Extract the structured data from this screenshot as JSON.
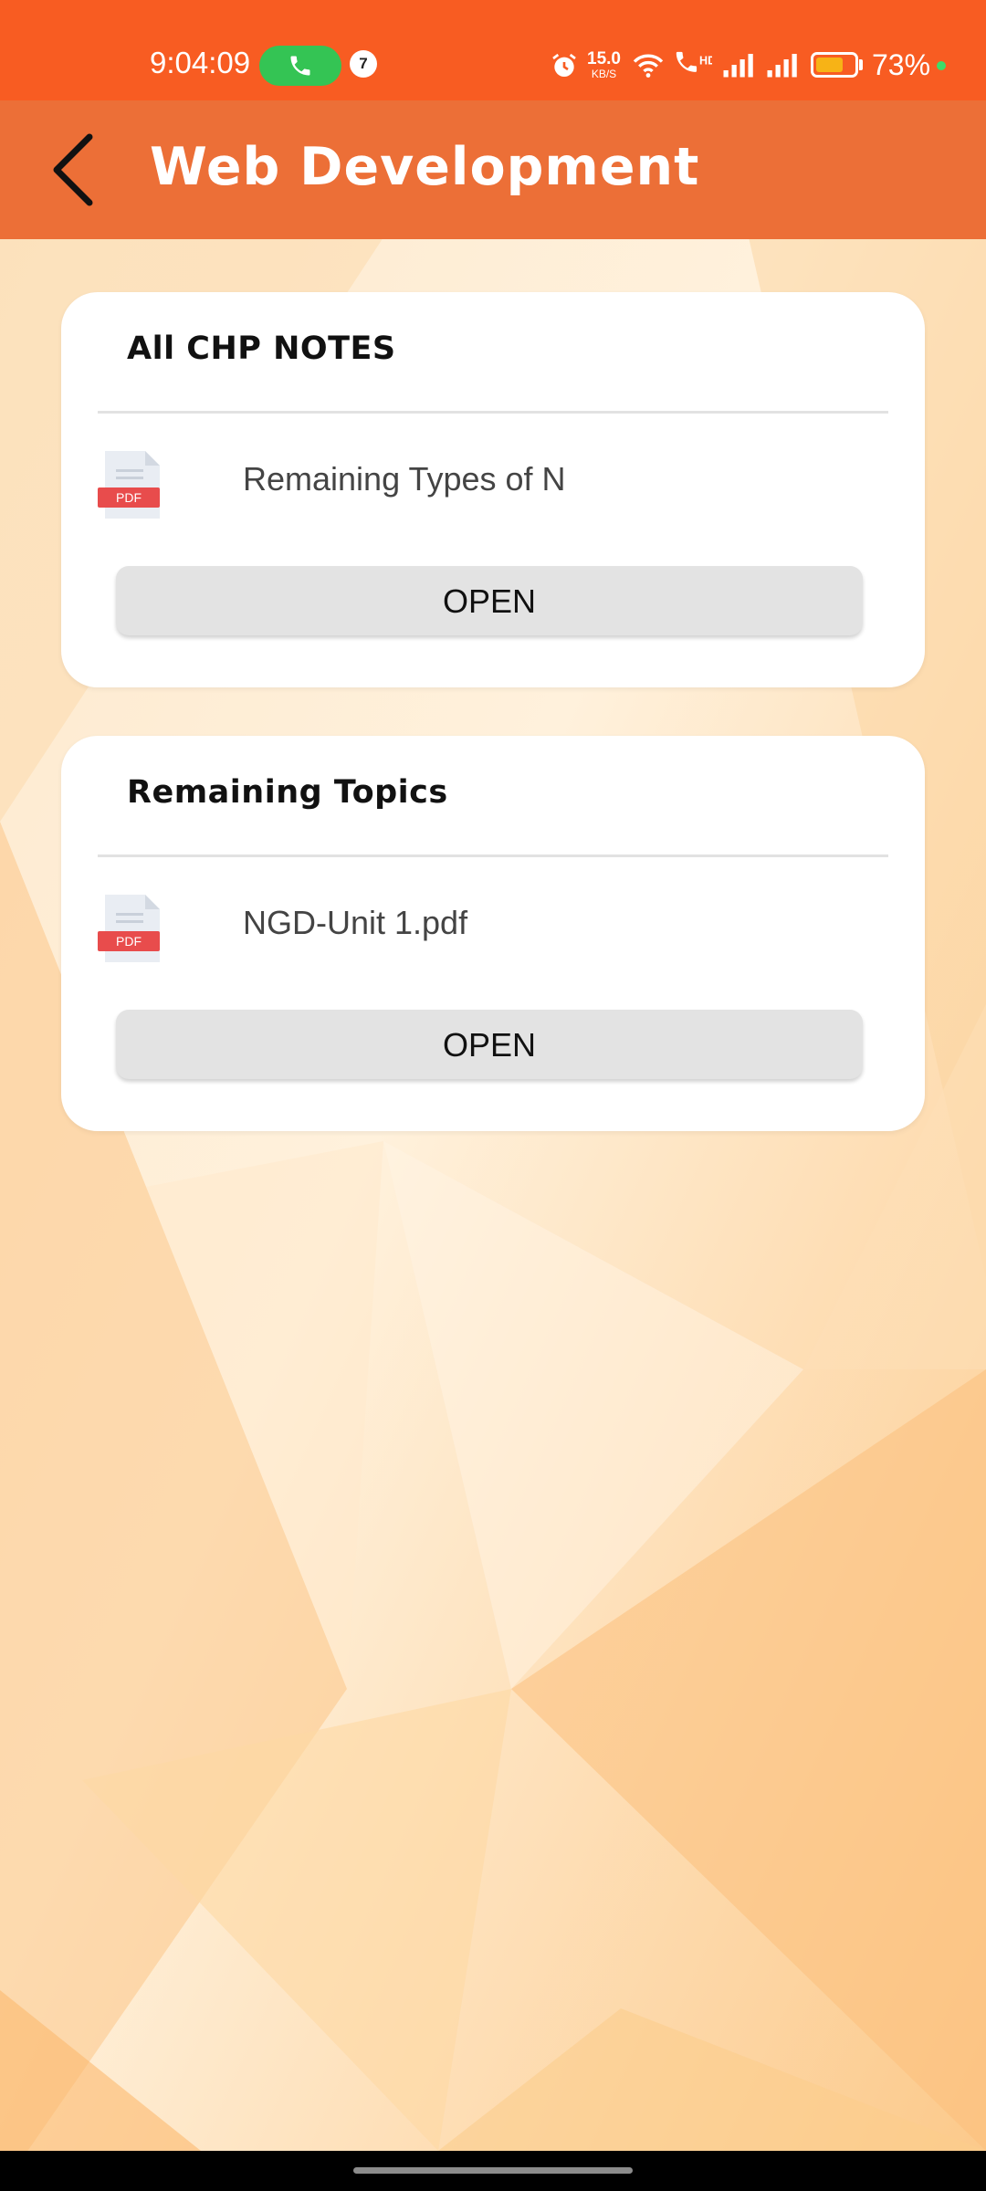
{
  "status_bar": {
    "time": "9:04:09",
    "notification_count": "7",
    "speed_value": "15.0",
    "speed_unit": "KB/S",
    "battery_percent": "73%",
    "battery_level": 0.73,
    "icons": [
      "call-icon",
      "alarm-icon",
      "wifi-icon",
      "wifi-calling-icon",
      "signal-icon",
      "signal-icon",
      "battery-icon"
    ]
  },
  "app_bar": {
    "title": "Web Development",
    "back_icon": "chevron-left-icon"
  },
  "cards": [
    {
      "title": "All CHP NOTES",
      "file_name": "Remaining Types of N",
      "file_icon_label": "PDF",
      "button_label": "OPEN"
    },
    {
      "title": "Remaining Topics",
      "file_name": "NGD-Unit 1.pdf",
      "file_icon_label": "PDF",
      "button_label": "OPEN"
    }
  ],
  "colors": {
    "status_bar": "#f85c22",
    "app_bar": "#ec6f37",
    "card_bg": "#ffffff",
    "button_bg": "#e3e3e3",
    "pdf_red": "#e84c4c"
  }
}
